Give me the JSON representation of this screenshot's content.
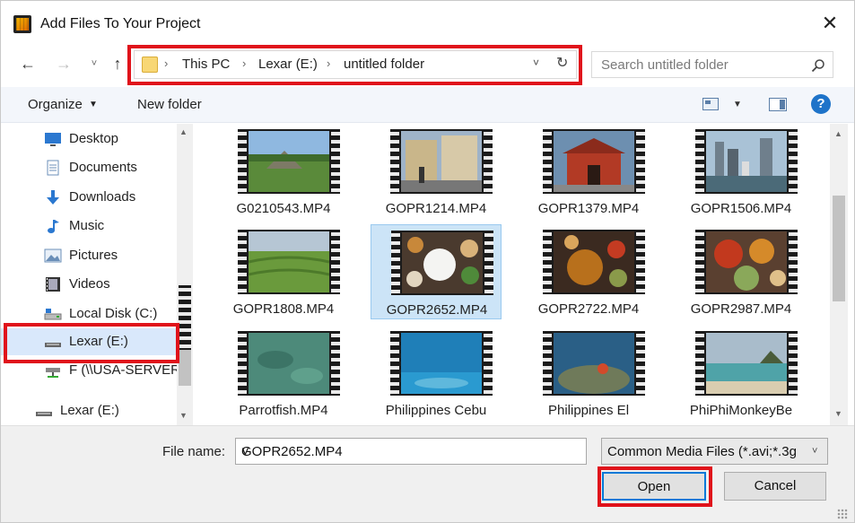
{
  "window": {
    "title": "Add Files To Your Project",
    "close_glyph": "✕"
  },
  "nav": {
    "back_glyph": "←",
    "forward_glyph": "→",
    "recent_glyph": "˅",
    "up_glyph": "↑"
  },
  "address": {
    "crumbs": [
      "This PC",
      "Lexar (E:)",
      "untitled folder"
    ],
    "separator": "›",
    "dropdown_glyph": "˅",
    "refresh_glyph": "↻"
  },
  "search": {
    "placeholder": "Search untitled folder"
  },
  "toolbar": {
    "organize_label": "Organize",
    "organize_caret": "▼",
    "new_folder_label": "New folder",
    "view_caret": "▼",
    "help_label": "?"
  },
  "sidebar": {
    "items": [
      {
        "label": "Desktop",
        "icon": "desktop-icon"
      },
      {
        "label": "Documents",
        "icon": "documents-icon"
      },
      {
        "label": "Downloads",
        "icon": "downloads-icon"
      },
      {
        "label": "Music",
        "icon": "music-icon"
      },
      {
        "label": "Pictures",
        "icon": "pictures-icon"
      },
      {
        "label": "Videos",
        "icon": "videos-icon"
      },
      {
        "label": "Local Disk (C:)",
        "icon": "drive-icon"
      },
      {
        "label": "Lexar (E:)",
        "icon": "usb-drive-icon",
        "selected": true
      },
      {
        "label": "F (\\\\USA-SERVER",
        "icon": "network-drive-icon"
      },
      {
        "label": "Lexar (E:)",
        "icon": "usb-drive-icon"
      }
    ],
    "scroll_up_glyph": "▲",
    "scroll_down_glyph": "▼"
  },
  "files": [
    {
      "name": "G0210543.MP4",
      "scene": "ruins"
    },
    {
      "name": "GOPR1214.MP4",
      "scene": "street"
    },
    {
      "name": "GOPR1379.MP4",
      "scene": "temple"
    },
    {
      "name": "GOPR1506.MP4",
      "scene": "skyline"
    },
    {
      "name": "GOPR1808.MP4",
      "scene": "tea-field"
    },
    {
      "name": "GOPR2652.MP4",
      "scene": "food-rice",
      "selected": true
    },
    {
      "name": "GOPR2722.MP4",
      "scene": "food-soup"
    },
    {
      "name": "GOPR2987.MP4",
      "scene": "food-spread"
    },
    {
      "name": "Parrotfish.MP4",
      "scene": "underwater-green"
    },
    {
      "name": "Philippines Cebu",
      "scene": "underwater-blue"
    },
    {
      "name": "Philippines El",
      "scene": "coral"
    },
    {
      "name": "PhiPhiMonkeyBe",
      "scene": "beach"
    }
  ],
  "footer": {
    "file_name_label": "File name:",
    "file_name_value": "GOPR2652.MP4",
    "file_type_value": "Common Media Files (*.avi;*.3g",
    "dropdown_glyph": "˅",
    "open_label": "Open",
    "cancel_label": "Cancel"
  },
  "colors": {
    "highlight_red": "#e0131b",
    "selection_blue": "#cce4f7",
    "accent_blue": "#0078d7"
  }
}
